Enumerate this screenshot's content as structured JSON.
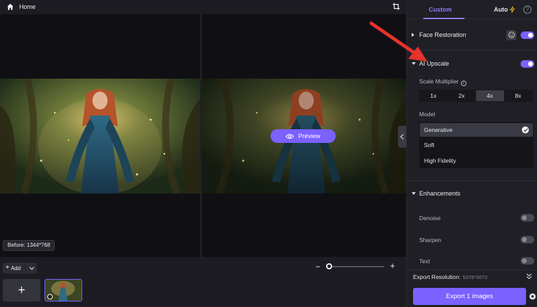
{
  "topbar": {
    "home_label": "Home"
  },
  "canvas": {
    "preview_label": "Preview",
    "before_label": "Before: 1344*768"
  },
  "bottombar": {
    "add_label": "Add"
  },
  "panel": {
    "tabs": {
      "custom": "Custom",
      "auto": "Auto"
    },
    "face_restoration": {
      "label": "Face Restoration",
      "enabled": true
    },
    "ai_upscale": {
      "label": "AI Upscale",
      "enabled": true,
      "scale_label": "Scale Multiplier",
      "scale_options": [
        "1x",
        "2x",
        "4x",
        "8x"
      ],
      "scale_selected": "4x",
      "model_label": "Model",
      "models": [
        "Generative",
        "Soft",
        "High Fidelity"
      ],
      "model_selected": "Generative"
    },
    "enhancements": {
      "label": "Enhancements",
      "items": [
        {
          "label": "Denoise",
          "enabled": false
        },
        {
          "label": "Sharpen",
          "enabled": false
        },
        {
          "label": "Text",
          "enabled": false
        }
      ]
    },
    "export": {
      "resolution_label": "Export Resolution:",
      "resolution_value": "5376*3072",
      "button_label": "Export 1 images"
    }
  },
  "colors": {
    "accent": "#7b61ff",
    "panel_bg": "#1f1f25",
    "annotation": "#e8322c"
  }
}
